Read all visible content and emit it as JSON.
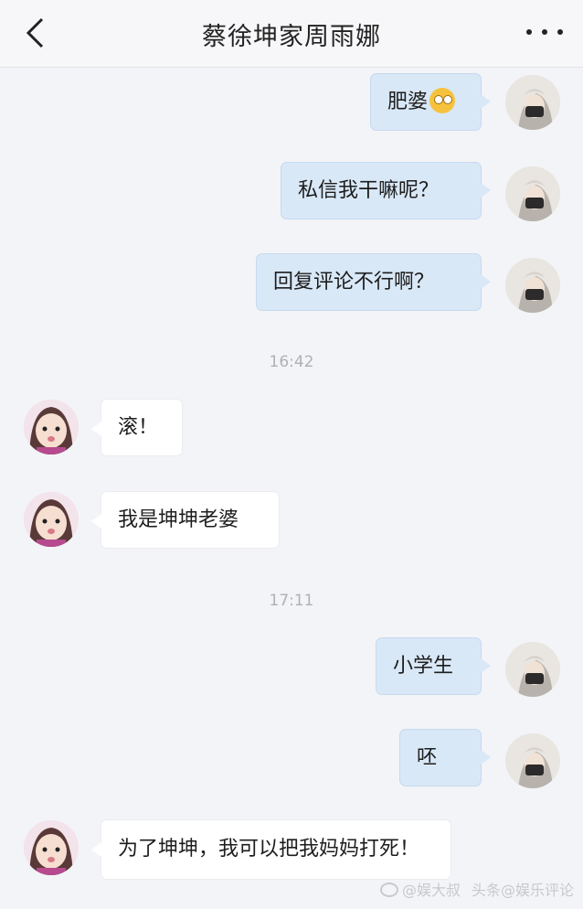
{
  "header": {
    "title": "蔡徐坤家周雨娜"
  },
  "messages": [
    {
      "text": "肥婆",
      "emoji": "eye-roll-emoji"
    },
    {
      "text": "私信我干嘛呢？"
    },
    {
      "text": "回复评论不行啊？"
    },
    {
      "time": "16:42"
    },
    {
      "text": "滚！"
    },
    {
      "text": "我是坤坤老婆"
    },
    {
      "time": "17:11"
    },
    {
      "text": "小学生"
    },
    {
      "text": "呸"
    },
    {
      "text": "为了坤坤，我可以把我妈妈打死！"
    }
  ],
  "watermark": {
    "left": "@娱大叔",
    "right": "头条@娱乐评论"
  },
  "colors": {
    "outgoing_bubble": "#d9e8f7",
    "incoming_bubble": "#ffffff",
    "background": "#f3f4f7"
  }
}
